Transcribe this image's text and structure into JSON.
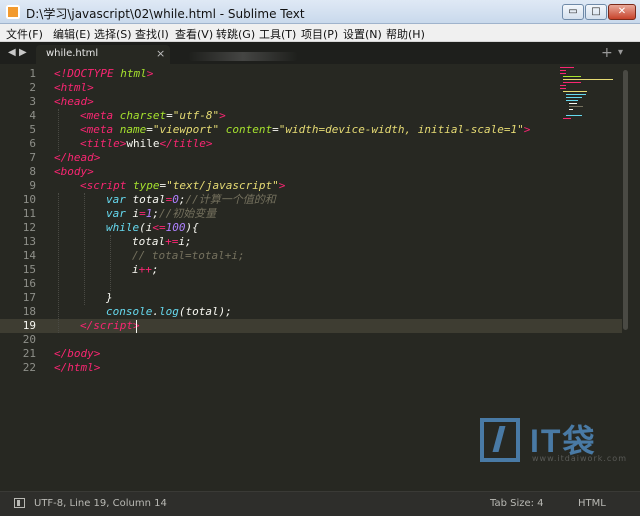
{
  "window": {
    "title": "D:\\学习\\javascript\\02\\while.html - Sublime Text",
    "min_glyph": "▭",
    "max_glyph": "□",
    "close_glyph": "✕"
  },
  "menu": [
    {
      "label": "文件(F)"
    },
    {
      "label": "编辑(E)"
    },
    {
      "label": "选择(S)"
    },
    {
      "label": "查找(I)"
    },
    {
      "label": "查看(V)"
    },
    {
      "label": "转跳(G)"
    },
    {
      "label": "工具(T)"
    },
    {
      "label": "项目(P)"
    },
    {
      "label": "设置(N)"
    },
    {
      "label": "帮助(H)"
    }
  ],
  "tabs": {
    "nav_left": "◀",
    "nav_right": "▶",
    "active_tab": "while.html",
    "close": "×",
    "plus": "+",
    "down": "▾"
  },
  "editor": {
    "current_line": 19,
    "lines": [
      {
        "num": "1"
      },
      {
        "num": "2"
      },
      {
        "num": "3"
      },
      {
        "num": "4"
      },
      {
        "num": "5"
      },
      {
        "num": "6"
      },
      {
        "num": "7"
      },
      {
        "num": "8"
      },
      {
        "num": "9"
      },
      {
        "num": "10"
      },
      {
        "num": "11"
      },
      {
        "num": "12"
      },
      {
        "num": "13"
      },
      {
        "num": "14"
      },
      {
        "num": "15"
      },
      {
        "num": "16"
      },
      {
        "num": "17"
      },
      {
        "num": "18"
      },
      {
        "num": "19"
      },
      {
        "num": "20"
      },
      {
        "num": "21"
      },
      {
        "num": "22"
      }
    ],
    "code": {
      "l1": [
        "<!",
        "DOCTYPE",
        " html",
        ">"
      ],
      "l2": [
        "<",
        "html",
        ">"
      ],
      "l3": [
        "<",
        "head",
        ">"
      ],
      "l4": [
        "<",
        "meta",
        " charset",
        "=",
        "\"utf-8\"",
        ">"
      ],
      "l5": [
        "<",
        "meta",
        " name",
        "=",
        "\"viewport\"",
        " content",
        "=",
        "\"width=device-width, initial-scale=1\"",
        ">"
      ],
      "l6": [
        "<",
        "title",
        ">",
        "while",
        "</",
        "title",
        ">"
      ],
      "l7": [
        "</",
        "head",
        ">"
      ],
      "l8": [
        "<",
        "body",
        ">"
      ],
      "l9": [
        "<",
        "script",
        " type",
        "=",
        "\"text/javascript\"",
        ">"
      ],
      "l10": [
        "var",
        " total",
        "=",
        "0",
        ";",
        "//计算一个值的和"
      ],
      "l11": [
        "var",
        " i",
        "=",
        "1",
        ";",
        "//初始变量"
      ],
      "l12": [
        "while",
        "(i",
        "<=",
        "100",
        "){"
      ],
      "l13": [
        "total",
        "+=",
        "i;"
      ],
      "l14": [
        "// total=total+i;"
      ],
      "l15": [
        "i",
        "++",
        ";"
      ],
      "l17": [
        "}"
      ],
      "l18": [
        "console",
        ".",
        "log",
        "(total);"
      ],
      "l19": [
        "</",
        "script",
        ">"
      ],
      "l21": [
        "</",
        "body",
        ">"
      ],
      "l22": [
        "</",
        "html",
        ">"
      ]
    }
  },
  "watermark": {
    "text": "IT袋",
    "sub": "www.itdaiwork.com"
  },
  "status": {
    "position": "UTF-8, Line 19, Column 14",
    "tab_size": "Tab Size: 4",
    "syntax": "HTML"
  },
  "colors": {
    "background": "#272822",
    "tag": "#f92672",
    "attribute": "#a6e22e",
    "string": "#e6db74",
    "keyword": "#66d9ef",
    "number": "#ae81ff",
    "comment": "#75715e"
  }
}
